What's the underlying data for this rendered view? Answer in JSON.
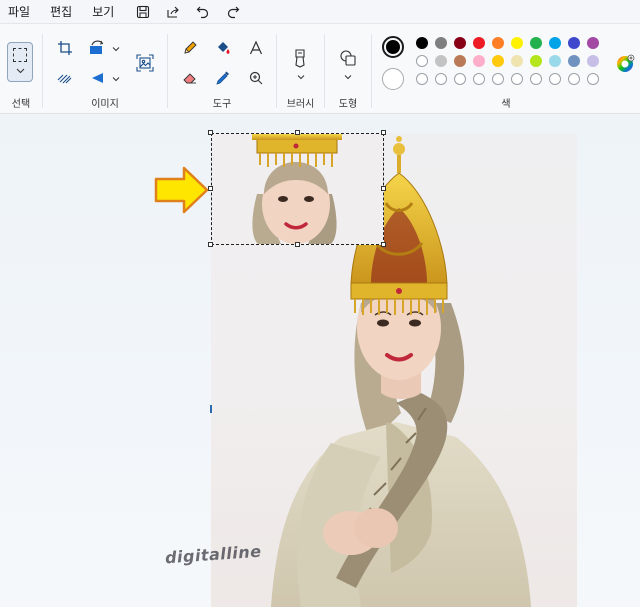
{
  "menu": {
    "file": "파일",
    "edit": "편집",
    "view": "보기"
  },
  "quick_access": [
    "save-icon",
    "share-icon",
    "undo-icon",
    "redo-icon"
  ],
  "ribbon": {
    "groups": {
      "select": "선택",
      "image": "이미지",
      "tools": "도구",
      "brushes": "브러시",
      "shapes": "도형",
      "colors": "색"
    }
  },
  "colors": {
    "primary": "#000000",
    "secondary": "#ffffff",
    "palette_row1": [
      "#000000",
      "#7f7f7f",
      "#880015",
      "#ed1c24",
      "#ff7f27",
      "#fff200",
      "#22b14c",
      "#00a2e8",
      "#3f48cc",
      "#a349a4"
    ],
    "palette_row2": [
      "#ffffff",
      "#c3c3c3",
      "#b97a57",
      "#ffaec9",
      "#ffc90e",
      "#efe4b0",
      "#b5e61d",
      "#99d9ea",
      "#7092be",
      "#c8bfe7"
    ],
    "palette_row3": [
      "#ffffff",
      "#ffffff",
      "#ffffff",
      "#ffffff",
      "#ffffff",
      "#ffffff",
      "#ffffff",
      "#ffffff",
      "#ffffff",
      "#ffffff"
    ]
  },
  "watermark": "digitalline"
}
